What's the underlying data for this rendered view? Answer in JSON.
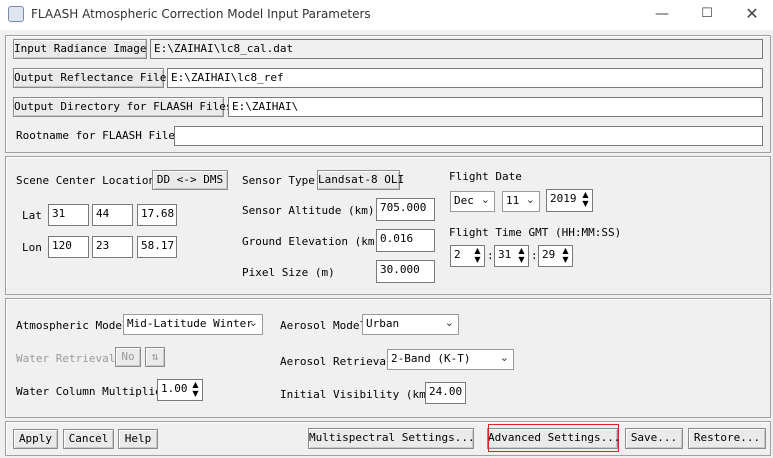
{
  "window": {
    "title": "FLAASH Atmospheric Correction Model Input Parameters"
  },
  "files": {
    "input_btn": "Input Radiance Image",
    "input_value": "E:\\ZAIHAI\\lc8_cal.dat",
    "output_refl_btn": "Output Reflectance File",
    "output_refl_value": "E:\\ZAIHAI\\lc8_ref",
    "output_dir_btn": "Output Directory for FLAASH Files",
    "output_dir_value": "E:\\ZAIHAI\\",
    "rootname_label": "Rootname for FLAASH Files",
    "rootname_value": ""
  },
  "scene": {
    "center_label": "Scene Center Location",
    "dd_dms_btn": "DD <-> DMS",
    "lat_label": "Lat",
    "lat": [
      "31",
      "44",
      "17.68"
    ],
    "lon_label": "Lon",
    "lon": [
      "120",
      "23",
      "58.17"
    ],
    "sensor_type_label": "Sensor Type",
    "sensor_type_value": "Landsat-8 OLI",
    "sensor_alt_label": "Sensor Altitude (km)",
    "sensor_alt_value": "705.000",
    "ground_elev_label": "Ground Elevation (km)",
    "ground_elev_value": "0.016",
    "pixel_size_label": "Pixel Size (m)",
    "pixel_size_value": "30.000",
    "flight_date_label": "Flight Date",
    "month": "Dec",
    "day": "11",
    "year": "2019",
    "flight_time_label": "Flight Time GMT (HH:MM:SS)",
    "hh": "2",
    "mm": "31",
    "ss": "29",
    "sep": ":"
  },
  "model": {
    "atmos_label": "Atmospheric Model",
    "atmos_value": "Mid-Latitude Winter",
    "water_retrieval_label": "Water Retrieval",
    "water_retrieval_value": "No",
    "water_col_label": "Water Column Multiplier",
    "water_col_value": "1.00",
    "aerosol_model_label": "Aerosol Model",
    "aerosol_model_value": "Urban",
    "aerosol_retrieval_label": "Aerosol Retrieval",
    "aerosol_retrieval_value": "2-Band (K-T)",
    "visibility_label": "Initial Visibility (km)",
    "visibility_value": "24.00"
  },
  "footer": {
    "apply": "Apply",
    "cancel": "Cancel",
    "help": "Help",
    "multispectral": "Multispectral Settings...",
    "advanced": "Advanced Settings...",
    "save": "Save...",
    "restore": "Restore..."
  },
  "colors": {
    "highlight_box": "#d9252a"
  }
}
